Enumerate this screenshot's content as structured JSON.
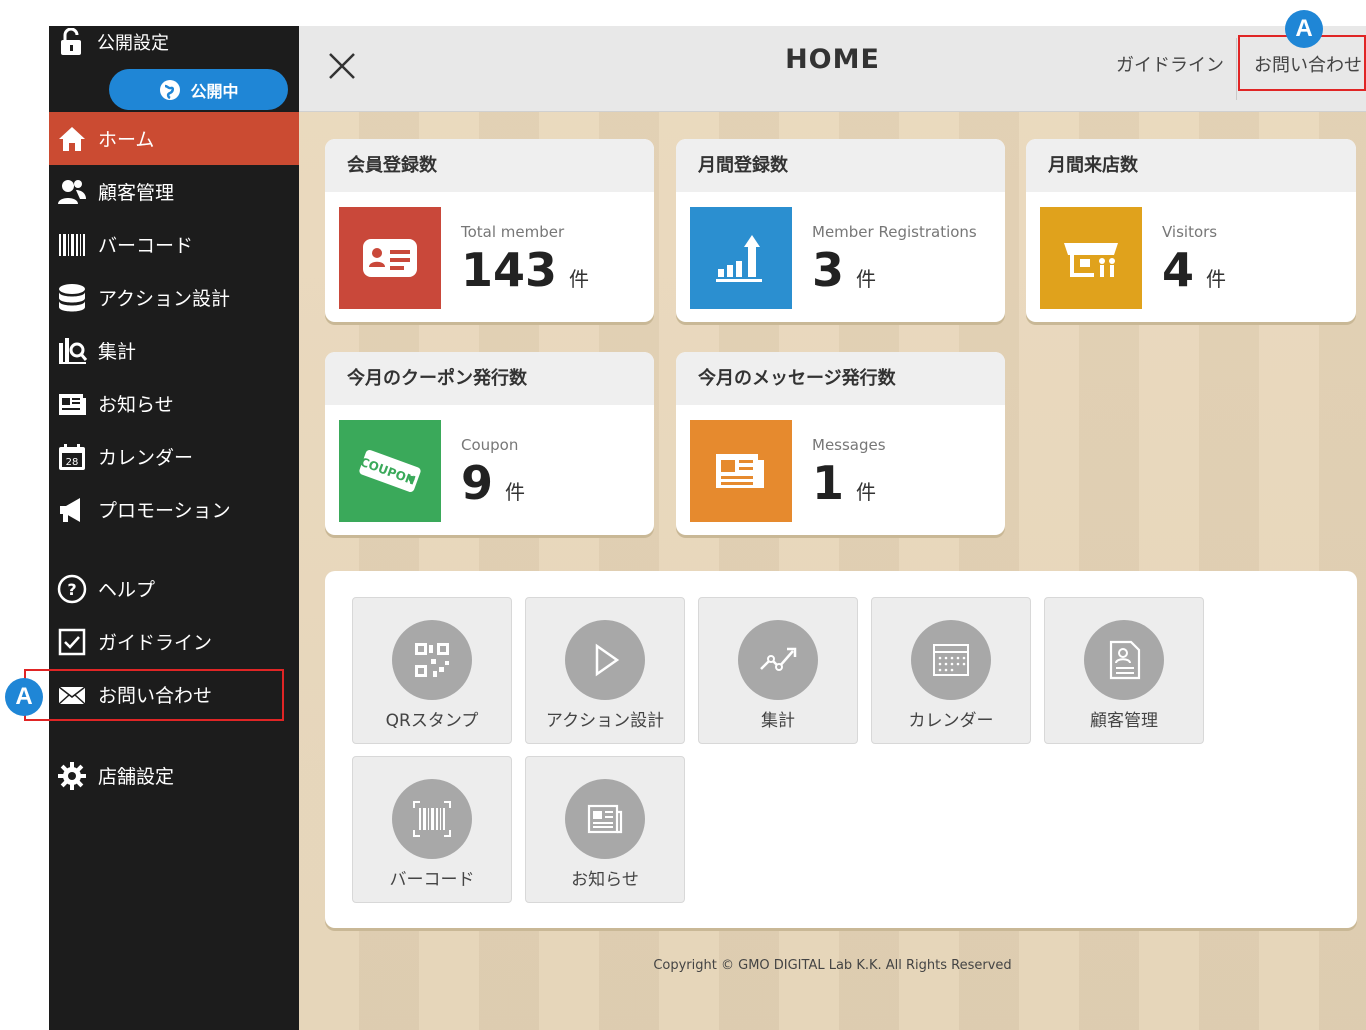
{
  "sidebar": {
    "publish_label": "公開設定",
    "publish_status": "公開中",
    "items": [
      {
        "label": "ホーム",
        "icon": "home-icon"
      },
      {
        "label": "顧客管理",
        "icon": "users-icon"
      },
      {
        "label": "バーコード",
        "icon": "barcode-icon"
      },
      {
        "label": "アクション設計",
        "icon": "database-icon"
      },
      {
        "label": "集計",
        "icon": "chart-search-icon"
      },
      {
        "label": "お知らせ",
        "icon": "news-icon"
      },
      {
        "label": "カレンダー",
        "icon": "calendar-icon"
      },
      {
        "label": "プロモーション",
        "icon": "megaphone-icon"
      },
      {
        "label": "ヘルプ",
        "icon": "help-icon"
      },
      {
        "label": "ガイドライン",
        "icon": "check-icon"
      },
      {
        "label": "お問い合わせ",
        "icon": "mail-icon"
      },
      {
        "label": "店舗設定",
        "icon": "gear-icon"
      }
    ]
  },
  "header": {
    "title": "HOME",
    "guideline": "ガイドライン",
    "contact": "お問い合わせ"
  },
  "cards": [
    {
      "title": "会員登録数",
      "label": "Total member",
      "value": "143",
      "unit": "件",
      "color": "#c9483a",
      "icon": "member-card-icon"
    },
    {
      "title": "月間登録数",
      "label": "Member Registrations",
      "value": "3",
      "unit": "件",
      "color": "#2b8fd0",
      "icon": "growth-chart-icon"
    },
    {
      "title": "月間来店数",
      "label": "Visitors",
      "value": "4",
      "unit": "件",
      "color": "#e0a21c",
      "icon": "store-icon"
    },
    {
      "title": "今月のクーポン発行数",
      "label": "Coupon",
      "value": "9",
      "unit": "件",
      "color": "#3aa95a",
      "icon": "coupon-icon"
    },
    {
      "title": "今月のメッセージ発行数",
      "label": "Messages",
      "value": "1",
      "unit": "件",
      "color": "#e68a2e",
      "icon": "message-icon"
    }
  ],
  "menu_tiles": [
    {
      "label": "QRスタンプ",
      "icon": "qr-icon"
    },
    {
      "label": "アクション設計",
      "icon": "play-icon"
    },
    {
      "label": "集計",
      "icon": "trend-icon"
    },
    {
      "label": "カレンダー",
      "icon": "calendar-icon"
    },
    {
      "label": "顧客管理",
      "icon": "customer-doc-icon"
    },
    {
      "label": "バーコード",
      "icon": "barcode-icon"
    },
    {
      "label": "お知らせ",
      "icon": "news-icon"
    }
  ],
  "copyright": "Copyright © GMO DIGITAL Lab K.K. All Rights Reserved",
  "annotation": {
    "badge": "A",
    "color": "#e02525"
  }
}
